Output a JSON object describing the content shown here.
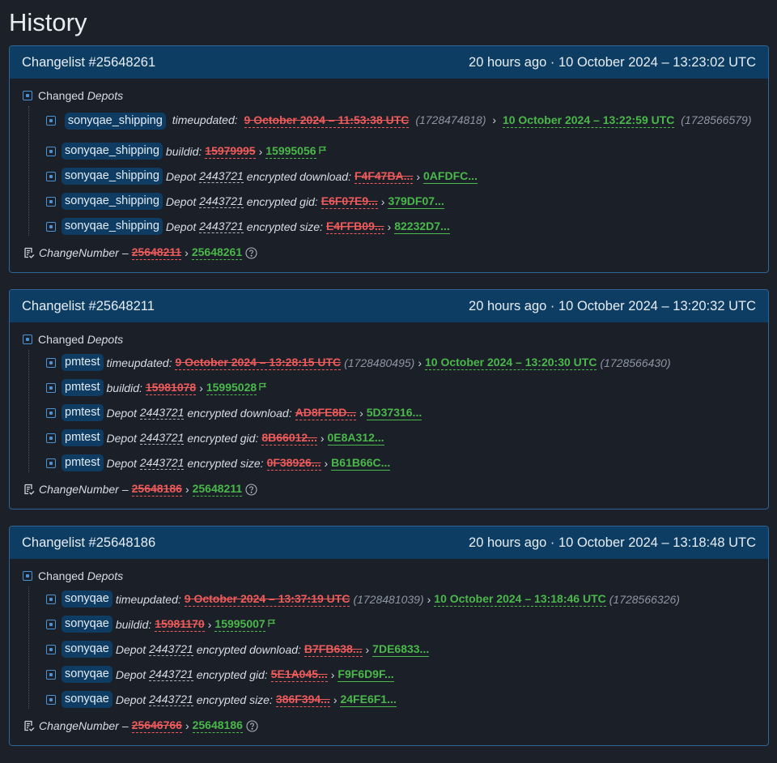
{
  "page": {
    "title": "History"
  },
  "labels": {
    "changed": "Changed",
    "depots": "Depots",
    "changenumber": "ChangeNumber",
    "dash": "–",
    "arrow": "›",
    "timeupdated": "timeupdated:",
    "buildid": "buildid:",
    "depot": "Depot",
    "enc_download": "encrypted download:",
    "enc_gid": "encrypted gid:",
    "enc_size": "encrypted size:"
  },
  "changelists": [
    {
      "title": "Changelist #25648261",
      "time": "20 hours ago · 10 October 2024 – 13:23:02 UTC",
      "app": "sonyqae_shipping",
      "time_old": "9 October 2024 – 11:53:38 UTC",
      "time_old_ts": "(1728474818)",
      "time_new": "10 October 2024 – 13:22:59 UTC",
      "time_new_ts": "(1728566579)",
      "build_old": "15979995",
      "build_new": "15995056",
      "depot_id": "2443721",
      "download_old": "F4F47BA...",
      "download_new": "0AFDFC...",
      "gid_old": "E6F07E9...",
      "gid_new": "379DF07...",
      "size_old": "E4FFB09...",
      "size_new": "82232D7...",
      "cn_old": "25648211",
      "cn_new": "25648261"
    },
    {
      "title": "Changelist #25648211",
      "time": "20 hours ago · 10 October 2024 – 13:20:32 UTC",
      "app": "pmtest",
      "time_old": "9 October 2024 – 13:28:15 UTC",
      "time_old_ts": "(1728480495)",
      "time_new": "10 October 2024 – 13:20:30 UTC",
      "time_new_ts": "(1728566430)",
      "build_old": "15981078",
      "build_new": "15995028",
      "depot_id": "2443721",
      "download_old": "AD8FE8D...",
      "download_new": "5D37316...",
      "gid_old": "8B66012...",
      "gid_new": "0E8A312...",
      "size_old": "0F38926...",
      "size_new": "B61B66C...",
      "cn_old": "25648186",
      "cn_new": "25648211"
    },
    {
      "title": "Changelist #25648186",
      "time": "20 hours ago · 10 October 2024 – 13:18:48 UTC",
      "app": "sonyqae",
      "time_old": "9 October 2024 – 13:37:19 UTC",
      "time_old_ts": "(1728481039)",
      "time_new": "10 October 2024 – 13:18:46 UTC",
      "time_new_ts": "(1728566326)",
      "build_old": "15981170",
      "build_new": "15995007",
      "depot_id": "2443721",
      "download_old": "B7FB638...",
      "download_new": "7DE6833...",
      "gid_old": "5E1A045...",
      "gid_new": "F9F6D9F...",
      "size_old": "386F394...",
      "size_new": "24FE6F1...",
      "cn_old": "25646766",
      "cn_new": "25648186"
    }
  ],
  "icons": {
    "node": "square-node-icon",
    "change": "document-check-icon",
    "help": "question-circle-icon",
    "flag": "flag-icon"
  },
  "colors": {
    "background": "#1b2029",
    "header": "#0e3d63",
    "old_value": "#ef5b5b",
    "new_value": "#4bb84b",
    "tag": "#0f3c63",
    "accent": "#4a93d6"
  }
}
